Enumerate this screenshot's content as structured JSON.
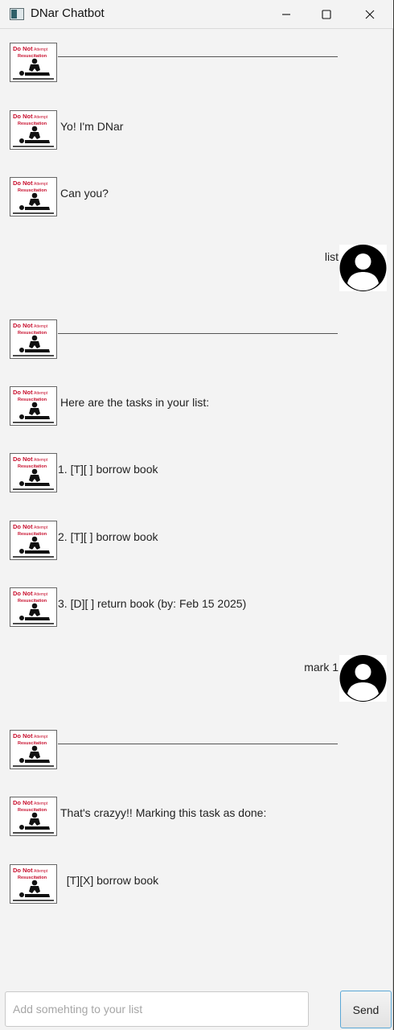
{
  "window": {
    "title": "DNar Chatbot",
    "controls": [
      "minimize-icon",
      "maximize-icon",
      "close-icon"
    ]
  },
  "bot_avatar": {
    "line1": "Do Not",
    "line1_small": "Attempt",
    "line2": "Resuscitation",
    "text_color": "#c8102e"
  },
  "user_avatar": {
    "icon": "person-silhouette-icon"
  },
  "messages": [
    {
      "sender": "bot",
      "type": "divider",
      "text": ""
    },
    {
      "sender": "bot",
      "type": "text",
      "text": "Yo! I'm DNar"
    },
    {
      "sender": "bot",
      "type": "text",
      "text": "Can you?"
    },
    {
      "sender": "user",
      "type": "text",
      "text": "list"
    },
    {
      "sender": "bot",
      "type": "divider",
      "text": ""
    },
    {
      "sender": "bot",
      "type": "text",
      "text": "Here are the tasks in your list:"
    },
    {
      "sender": "bot",
      "type": "text",
      "text": "1. [T][ ] borrow book"
    },
    {
      "sender": "bot",
      "type": "text",
      "text": "2. [T][ ] borrow book"
    },
    {
      "sender": "bot",
      "type": "text",
      "text": "3. [D][ ] return book (by: Feb 15 2025)"
    },
    {
      "sender": "user",
      "type": "text",
      "text": "mark 1"
    },
    {
      "sender": "bot",
      "type": "divider",
      "text": ""
    },
    {
      "sender": "bot",
      "type": "text",
      "text": "That's crazyy!! Marking this task as done:"
    },
    {
      "sender": "bot",
      "type": "text",
      "text": "  [T][X] borrow book"
    }
  ],
  "input": {
    "value": "",
    "placeholder": "Add somehting to your list"
  },
  "send_button": {
    "label": "Send",
    "border_color": "#5aa7d6"
  }
}
